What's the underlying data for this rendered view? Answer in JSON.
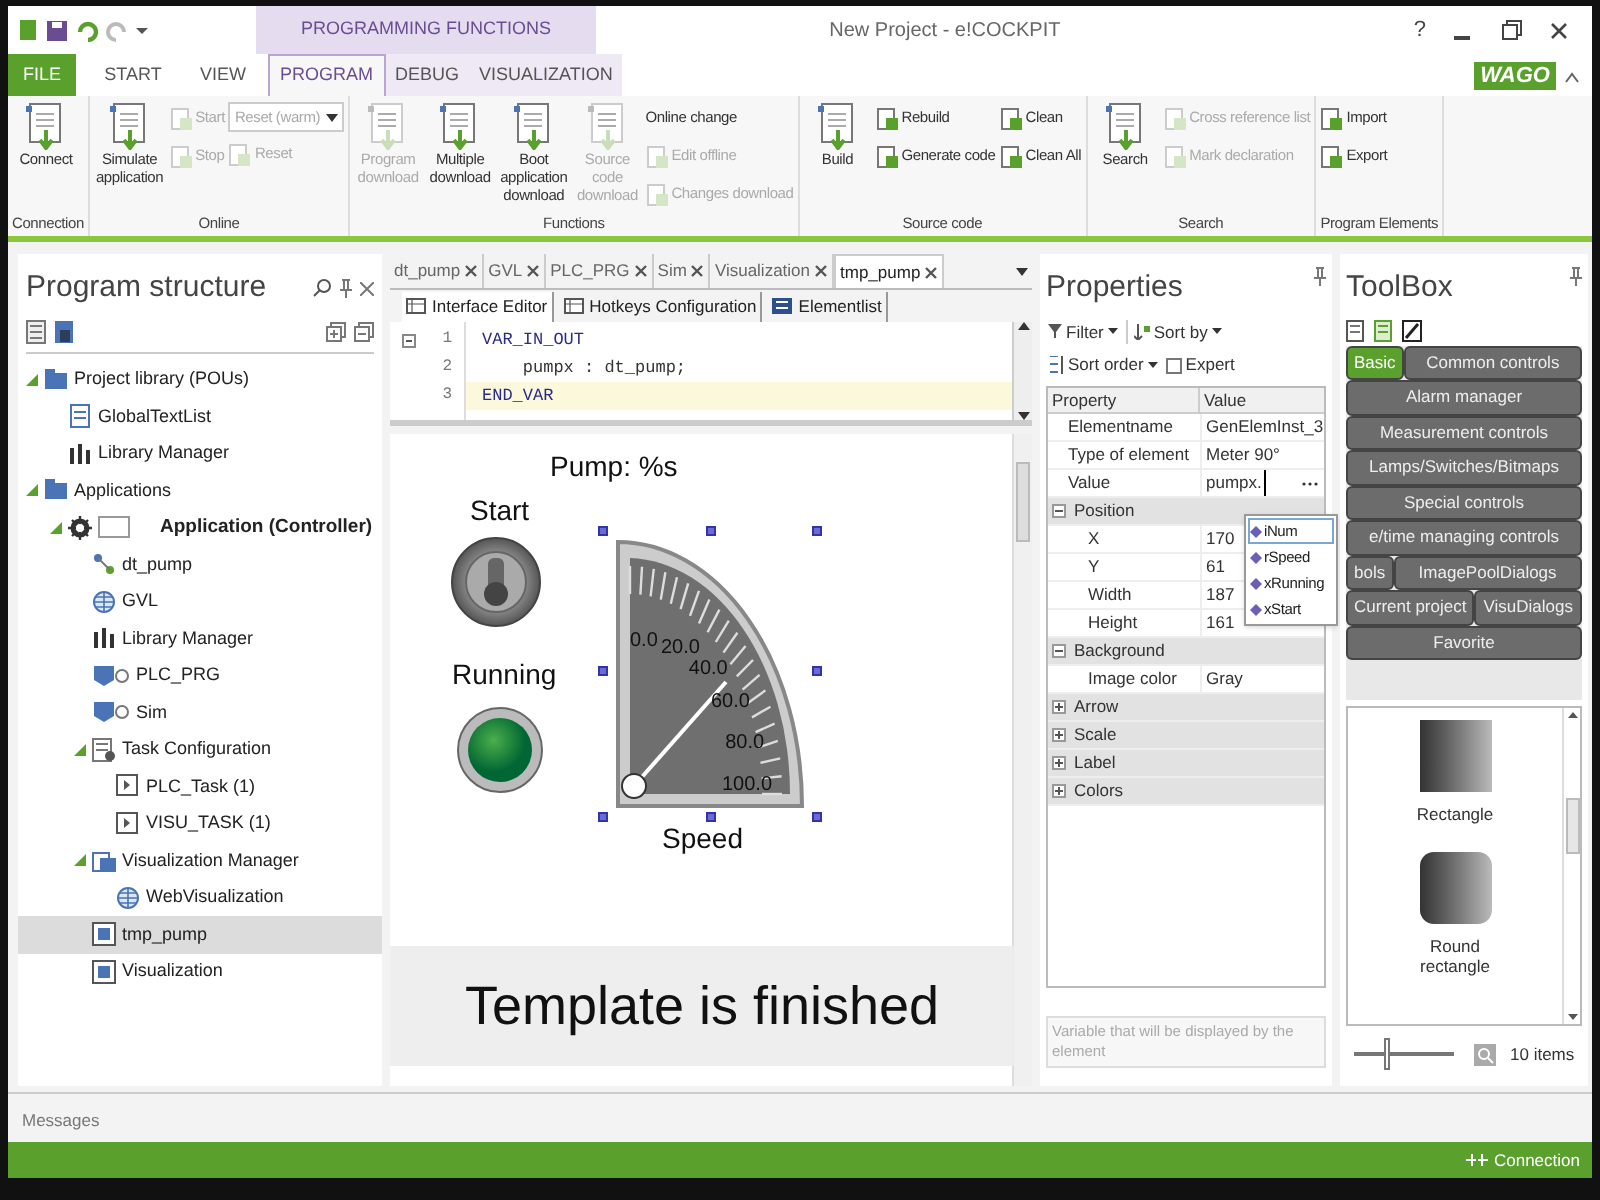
{
  "title_bar": {
    "title": "New Project - e!COCKPIT",
    "context_tab": "PROGRAMMING FUNCTIONS",
    "help": "?"
  },
  "ribbon_tabs": [
    {
      "label": "FILE",
      "kind": "file",
      "selected": false
    },
    {
      "label": "START",
      "kind": "tab",
      "selected": false
    },
    {
      "label": "VIEW",
      "kind": "tab",
      "selected": false
    },
    {
      "label": "PROGRAM",
      "kind": "context",
      "selected": true
    },
    {
      "label": "DEBUG",
      "kind": "context",
      "selected": false
    },
    {
      "label": "VISUALIZATION",
      "kind": "context",
      "selected": false
    }
  ],
  "logo": "WAGO",
  "ribbon_groups": [
    {
      "label": "Connection",
      "columns": [
        [
          {
            "label": "Connect",
            "kind": "large",
            "disabled": false
          }
        ]
      ]
    },
    {
      "label": "Online",
      "columns": [
        [
          {
            "label": "Simulate application",
            "kind": "large",
            "disabled": false
          }
        ],
        [
          {
            "label": "Start",
            "kind": "small",
            "disabled": true
          },
          {
            "label": "Stop",
            "kind": "small",
            "disabled": true
          }
        ],
        [
          {
            "label": "Reset (warm)",
            "kind": "dropdown",
            "disabled": true
          },
          {
            "label": "Reset",
            "kind": "small",
            "disabled": true
          }
        ]
      ]
    },
    {
      "label": "Functions",
      "columns": [
        [
          {
            "label": "Program download",
            "kind": "large",
            "disabled": true
          }
        ],
        [
          {
            "label": "Multiple download",
            "kind": "large",
            "disabled": false
          }
        ],
        [
          {
            "label": "Boot application download",
            "kind": "large",
            "disabled": false
          }
        ],
        [
          {
            "label": "Source code download",
            "kind": "large",
            "disabled": true
          }
        ],
        [
          {
            "label": "Online change",
            "kind": "text",
            "disabled": false
          },
          {
            "label": "Edit offline",
            "kind": "small",
            "disabled": true
          },
          {
            "label": "Changes download",
            "kind": "small",
            "disabled": true
          }
        ]
      ]
    },
    {
      "label": "Source code",
      "columns": [
        [
          {
            "label": "Build",
            "kind": "large",
            "disabled": false
          }
        ],
        [
          {
            "label": "Rebuild",
            "kind": "small",
            "disabled": false
          },
          {
            "label": "Generate code",
            "kind": "small",
            "disabled": false
          }
        ],
        [
          {
            "label": "Clean",
            "kind": "small",
            "disabled": false
          },
          {
            "label": "Clean All",
            "kind": "small",
            "disabled": false
          }
        ]
      ]
    },
    {
      "label": "Search",
      "columns": [
        [
          {
            "label": "Search",
            "kind": "large",
            "disabled": false
          }
        ],
        [
          {
            "label": "Cross reference list",
            "kind": "small",
            "disabled": true
          },
          {
            "label": "Mark declaration",
            "kind": "small",
            "disabled": true
          }
        ]
      ]
    },
    {
      "label": "Program Elements",
      "columns": [
        [
          {
            "label": "Import",
            "kind": "small",
            "disabled": false
          },
          {
            "label": "Export",
            "kind": "small",
            "disabled": false
          }
        ]
      ]
    }
  ],
  "program_structure": {
    "title": "Program structure",
    "tree": [
      {
        "label": "Project library (POUs)",
        "kind": "folder",
        "expanded": true,
        "selected": false,
        "children": [
          {
            "label": "GlobalTextList",
            "kind": "list",
            "selected": false
          },
          {
            "label": "Library Manager",
            "kind": "library",
            "selected": false
          }
        ]
      },
      {
        "label": "Applications",
        "kind": "folder",
        "expanded": true,
        "selected": false,
        "children": [
          {
            "label": "Application (Controller)",
            "kind": "app",
            "expanded": true,
            "selected": false,
            "children": [
              {
                "label": "dt_pump",
                "kind": "type",
                "selected": false
              },
              {
                "label": "GVL",
                "kind": "globe",
                "selected": false
              },
              {
                "label": "Library Manager",
                "kind": "library",
                "selected": false
              },
              {
                "label": "PLC_PRG",
                "kind": "program",
                "selected": false
              },
              {
                "label": "Sim",
                "kind": "program",
                "selected": false
              },
              {
                "label": "Task Configuration",
                "kind": "tasks",
                "expanded": true,
                "selected": false,
                "children": [
                  {
                    "label": "PLC_Task (1)",
                    "kind": "task",
                    "selected": false
                  },
                  {
                    "label": "VISU_TASK (1)",
                    "kind": "task",
                    "selected": false
                  }
                ]
              },
              {
                "label": "Visualization Manager",
                "kind": "visumanager",
                "expanded": true,
                "selected": false,
                "children": [
                  {
                    "label": "WebVisualization",
                    "kind": "globe",
                    "selected": false
                  }
                ]
              },
              {
                "label": "tmp_pump",
                "kind": "visu",
                "selected": true
              },
              {
                "label": "Visualization",
                "kind": "visu",
                "selected": false
              }
            ]
          }
        ]
      }
    ]
  },
  "editor_tabs": [
    {
      "label": "dt_pump",
      "selected": false
    },
    {
      "label": "GVL",
      "selected": false
    },
    {
      "label": "PLC_PRG",
      "selected": false
    },
    {
      "label": "Sim",
      "selected": false
    },
    {
      "label": "Visualization",
      "selected": false
    },
    {
      "label": "tmp_pump",
      "selected": true
    }
  ],
  "editor_subtabs": [
    {
      "label": "Interface Editor",
      "selected": true
    },
    {
      "label": "Hotkeys Configuration",
      "selected": false
    },
    {
      "label": "Elementlist",
      "selected": false
    }
  ],
  "code_lines": [
    {
      "number": "1",
      "text": "VAR_IN_OUT",
      "current": false
    },
    {
      "number": "2",
      "text": "    pumpx : dt_pump;",
      "current": false
    },
    {
      "number": "3",
      "text": "END_VAR",
      "current": true
    }
  ],
  "canvas": {
    "title": "Pump: %s",
    "switch_label": "Start",
    "lamp_label": "Running",
    "gauge_scale": [
      "0.0",
      "20.0",
      "40.0",
      "60.0",
      "80.0",
      "100.0"
    ],
    "gauge_label": "Speed"
  },
  "caption": "Template is finished",
  "properties": {
    "title": "Properties",
    "filter": "Filter",
    "sort_by": "Sort by",
    "sort_order": "Sort order",
    "expert": {
      "label": "Expert",
      "checked": false
    },
    "columns": [
      "Property",
      "Value"
    ],
    "rows": [
      {
        "kind": "row",
        "name": "Elementname",
        "value": "GenElemInst_3"
      },
      {
        "kind": "row",
        "name": "Type of element",
        "value": "Meter 90°"
      },
      {
        "kind": "edit",
        "name": "Value",
        "value": "pumpx."
      },
      {
        "kind": "group",
        "name": "Position",
        "expanded": true
      },
      {
        "kind": "sub",
        "name": "X",
        "value": "170"
      },
      {
        "kind": "sub",
        "name": "Y",
        "value": "61"
      },
      {
        "kind": "sub",
        "name": "Width",
        "value": "187"
      },
      {
        "kind": "sub",
        "name": "Height",
        "value": "161"
      },
      {
        "kind": "group",
        "name": "Background",
        "expanded": true
      },
      {
        "kind": "sub",
        "name": "Image color",
        "value": "Gray"
      },
      {
        "kind": "group",
        "name": "Arrow",
        "expanded": false
      },
      {
        "kind": "group",
        "name": "Scale",
        "expanded": false
      },
      {
        "kind": "group",
        "name": "Label",
        "expanded": false
      },
      {
        "kind": "group",
        "name": "Colors",
        "expanded": false
      }
    ],
    "autocomplete": [
      {
        "label": "iNum",
        "selected": true
      },
      {
        "label": "rSpeed",
        "selected": false
      },
      {
        "label": "xRunning",
        "selected": false
      },
      {
        "label": "xStart",
        "selected": false
      }
    ],
    "description": "Variable that will be displayed by the element"
  },
  "toolbox": {
    "title": "ToolBox",
    "category_rows": [
      [
        {
          "label": "Basic",
          "selected": true
        },
        {
          "label": "Common controls",
          "selected": false
        }
      ],
      [
        {
          "label": "Alarm manager",
          "selected": false
        }
      ],
      [
        {
          "label": "Measurement controls",
          "selected": false
        }
      ],
      [
        {
          "label": "Lamps/Switches/Bitmaps",
          "selected": false
        }
      ],
      [
        {
          "label": "Special controls",
          "selected": false
        }
      ],
      [
        {
          "label": "e/time managing controls",
          "selected": false
        }
      ],
      [
        {
          "label": "bols",
          "selected": false
        },
        {
          "label": "ImagePoolDialogs",
          "selected": false
        }
      ],
      [
        {
          "label": "Current project",
          "selected": false
        },
        {
          "label": "VisuDialogs",
          "selected": false
        }
      ],
      [
        {
          "label": "Favorite",
          "selected": false
        }
      ]
    ],
    "items": [
      {
        "label": "Rectangle",
        "kind": "rect"
      },
      {
        "label": "Round rectangle",
        "kind": "round"
      }
    ],
    "zoom": {
      "level": 0.3
    },
    "count": "10 items"
  },
  "messages_tab": "Messages",
  "status": "Connection"
}
